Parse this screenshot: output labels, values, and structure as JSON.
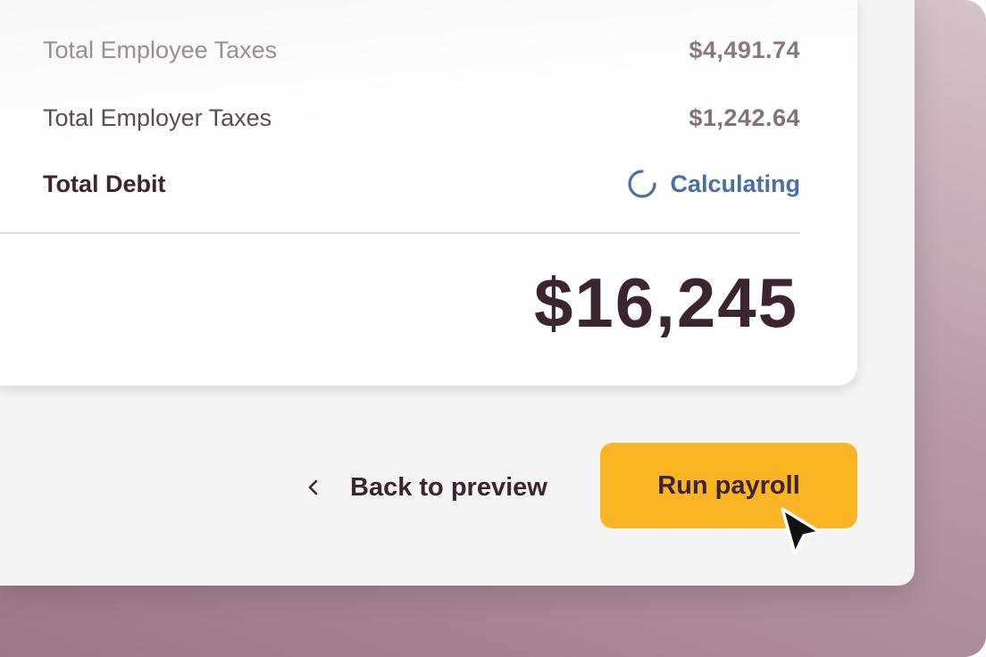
{
  "summary": {
    "rows": [
      {
        "label": "Total Employee Taxes",
        "value": "$4,491.74"
      },
      {
        "label": "Total Employer Taxes",
        "value": "$1,242.64"
      },
      {
        "label": "Total Debit",
        "status": "Calculating",
        "status_icon": "spinner-icon"
      }
    ],
    "total": "$16,245"
  },
  "actions": {
    "back_label": "Back to preview",
    "back_icon": "chevron-left-icon",
    "run_label": "Run payroll"
  },
  "colors": {
    "accent_button": "#fbb423",
    "status_blue": "#4a6ea5",
    "text_dark": "#3b2530",
    "backdrop": "#b598a6"
  }
}
